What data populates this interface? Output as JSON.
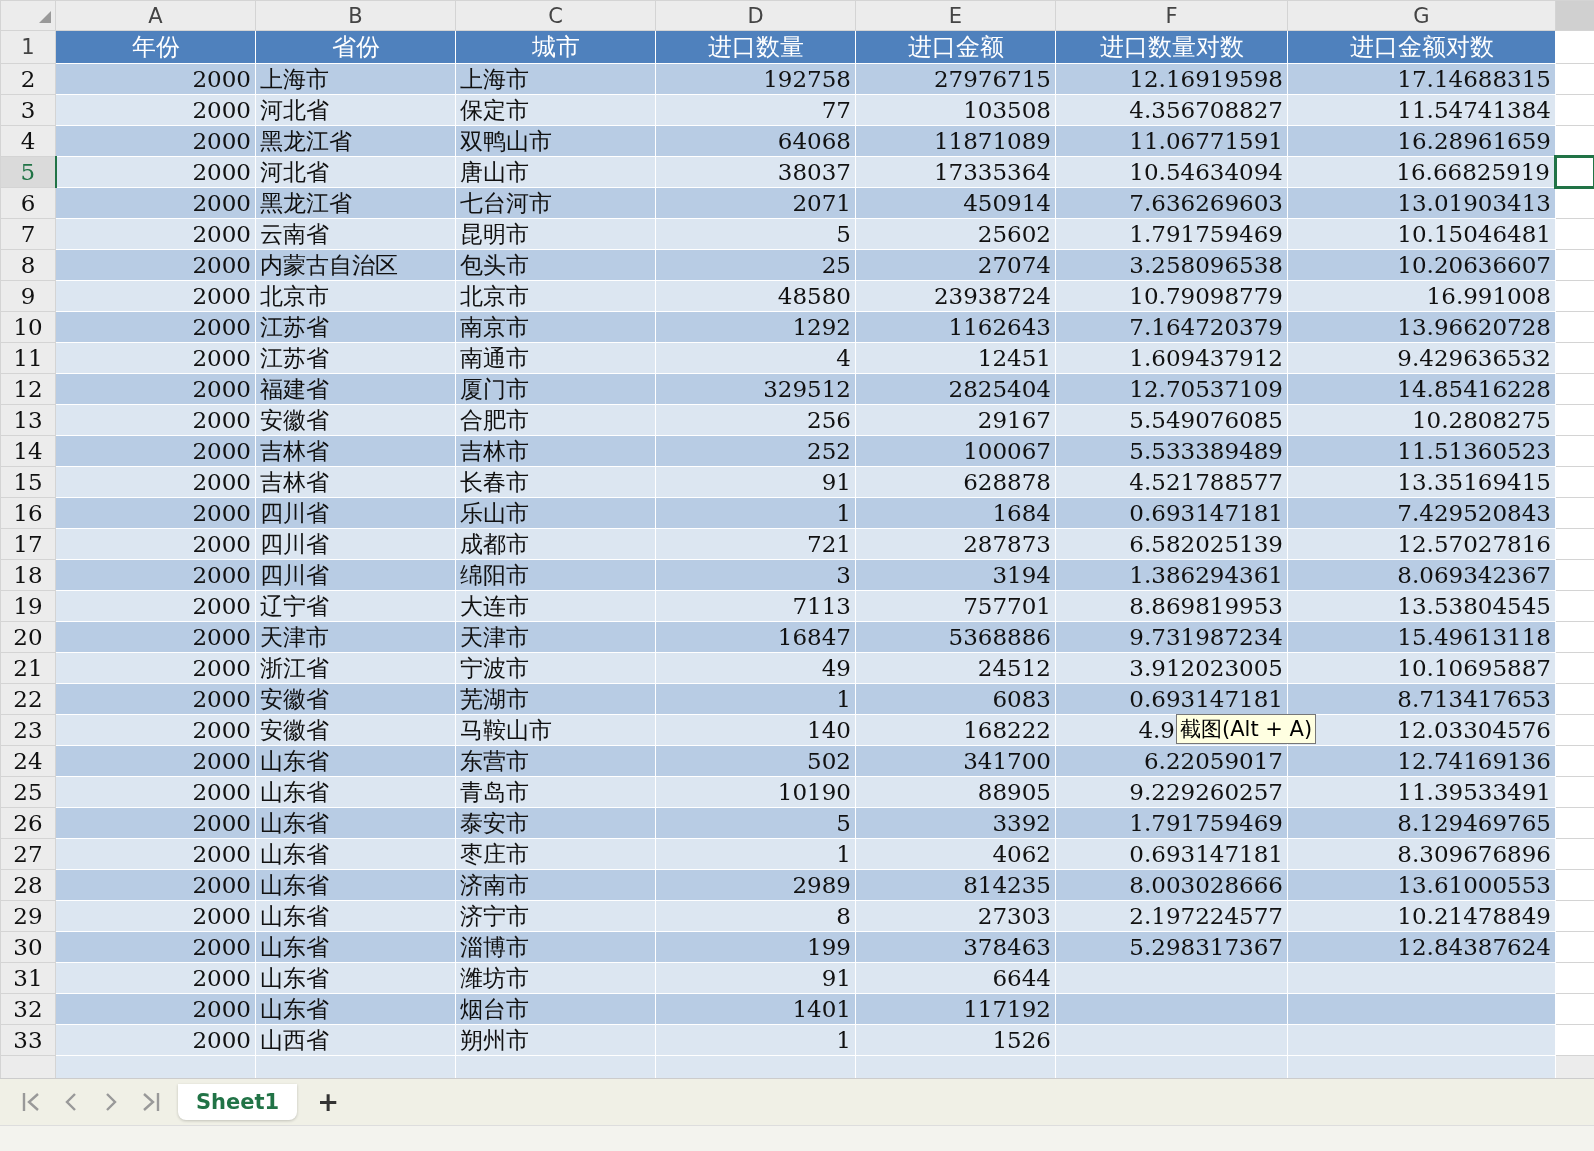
{
  "columns": [
    {
      "letter": "A",
      "selected": false
    },
    {
      "letter": "B",
      "selected": false
    },
    {
      "letter": "C",
      "selected": false
    },
    {
      "letter": "D",
      "selected": false
    },
    {
      "letter": "E",
      "selected": false
    },
    {
      "letter": "F",
      "selected": false
    },
    {
      "letter": "G",
      "selected": false
    }
  ],
  "header_row": {
    "number": "1",
    "cells": [
      "年份",
      "省份",
      "城市",
      "进口数量",
      "进口金额",
      "进口数量对数",
      "进口金额对数"
    ]
  },
  "rows": [
    {
      "number": "2",
      "selected": false,
      "cells": [
        "2000",
        "上海市",
        "上海市",
        "192758",
        "27976715",
        "12.16919598",
        "17.14688315"
      ]
    },
    {
      "number": "3",
      "selected": false,
      "cells": [
        "2000",
        "河北省",
        "保定市",
        "77",
        "103508",
        "4.356708827",
        "11.54741384"
      ]
    },
    {
      "number": "4",
      "selected": false,
      "cells": [
        "2000",
        "黑龙江省",
        "双鸭山市",
        "64068",
        "11871089",
        "11.06771591",
        "16.28961659"
      ]
    },
    {
      "number": "5",
      "selected": true,
      "cells": [
        "2000",
        "河北省",
        "唐山市",
        "38037",
        "17335364",
        "10.54634094",
        "16.66825919"
      ]
    },
    {
      "number": "6",
      "selected": false,
      "cells": [
        "2000",
        "黑龙江省",
        "七台河市",
        "2071",
        "450914",
        "7.636269603",
        "13.01903413"
      ]
    },
    {
      "number": "7",
      "selected": false,
      "cells": [
        "2000",
        "云南省",
        "昆明市",
        "5",
        "25602",
        "1.791759469",
        "10.15046481"
      ]
    },
    {
      "number": "8",
      "selected": false,
      "cells": [
        "2000",
        "内蒙古自治区",
        "包头市",
        "25",
        "27074",
        "3.258096538",
        "10.20636607"
      ]
    },
    {
      "number": "9",
      "selected": false,
      "cells": [
        "2000",
        "北京市",
        "北京市",
        "48580",
        "23938724",
        "10.79098779",
        "16.991008"
      ]
    },
    {
      "number": "10",
      "selected": false,
      "cells": [
        "2000",
        "江苏省",
        "南京市",
        "1292",
        "1162643",
        "7.164720379",
        "13.96620728"
      ]
    },
    {
      "number": "11",
      "selected": false,
      "cells": [
        "2000",
        "江苏省",
        "南通市",
        "4",
        "12451",
        "1.609437912",
        "9.429636532"
      ]
    },
    {
      "number": "12",
      "selected": false,
      "cells": [
        "2000",
        "福建省",
        "厦门市",
        "329512",
        "2825404",
        "12.70537109",
        "14.85416228"
      ]
    },
    {
      "number": "13",
      "selected": false,
      "cells": [
        "2000",
        "安徽省",
        "合肥市",
        "256",
        "29167",
        "5.549076085",
        "10.2808275"
      ]
    },
    {
      "number": "14",
      "selected": false,
      "cells": [
        "2000",
        "吉林省",
        "吉林市",
        "252",
        "100067",
        "5.533389489",
        "11.51360523"
      ]
    },
    {
      "number": "15",
      "selected": false,
      "cells": [
        "2000",
        "吉林省",
        "长春市",
        "91",
        "628878",
        "4.521788577",
        "13.35169415"
      ]
    },
    {
      "number": "16",
      "selected": false,
      "cells": [
        "2000",
        "四川省",
        "乐山市",
        "1",
        "1684",
        "0.693147181",
        "7.429520843"
      ]
    },
    {
      "number": "17",
      "selected": false,
      "cells": [
        "2000",
        "四川省",
        "成都市",
        "721",
        "287873",
        "6.582025139",
        "12.57027816"
      ]
    },
    {
      "number": "18",
      "selected": false,
      "cells": [
        "2000",
        "四川省",
        "绵阳市",
        "3",
        "3194",
        "1.386294361",
        "8.069342367"
      ]
    },
    {
      "number": "19",
      "selected": false,
      "cells": [
        "2000",
        "辽宁省",
        "大连市",
        "7113",
        "757701",
        "8.869819953",
        "13.53804545"
      ]
    },
    {
      "number": "20",
      "selected": false,
      "cells": [
        "2000",
        "天津市",
        "天津市",
        "16847",
        "5368886",
        "9.731987234",
        "15.49613118"
      ]
    },
    {
      "number": "21",
      "selected": false,
      "cells": [
        "2000",
        "浙江省",
        "宁波市",
        "49",
        "24512",
        "3.912023005",
        "10.10695887"
      ]
    },
    {
      "number": "22",
      "selected": false,
      "cells": [
        "2000",
        "安徽省",
        "芜湖市",
        "1",
        "6083",
        "0.693147181",
        "8.713417653"
      ]
    },
    {
      "number": "23",
      "selected": false,
      "cells": [
        "2000",
        "安徽省",
        "马鞍山市",
        "140",
        "168222",
        "4.9",
        "12.03304576"
      ],
      "tooltip": "截图(Alt + A)"
    },
    {
      "number": "24",
      "selected": false,
      "cells": [
        "2000",
        "山东省",
        "东营市",
        "502",
        "341700",
        "6.22059017",
        "12.74169136"
      ]
    },
    {
      "number": "25",
      "selected": false,
      "cells": [
        "2000",
        "山东省",
        "青岛市",
        "10190",
        "88905",
        "9.229260257",
        "11.39533491"
      ]
    },
    {
      "number": "26",
      "selected": false,
      "cells": [
        "2000",
        "山东省",
        "泰安市",
        "5",
        "3392",
        "1.791759469",
        "8.129469765"
      ]
    },
    {
      "number": "27",
      "selected": false,
      "cells": [
        "2000",
        "山东省",
        "枣庄市",
        "1",
        "4062",
        "0.693147181",
        "8.309676896"
      ]
    },
    {
      "number": "28",
      "selected": false,
      "cells": [
        "2000",
        "山东省",
        "济南市",
        "2989",
        "814235",
        "8.003028666",
        "13.61000553"
      ]
    },
    {
      "number": "29",
      "selected": false,
      "cells": [
        "2000",
        "山东省",
        "济宁市",
        "8",
        "27303",
        "2.197224577",
        "10.21478849"
      ]
    },
    {
      "number": "30",
      "selected": false,
      "cells": [
        "2000",
        "山东省",
        "淄博市",
        "199",
        "378463",
        "5.298317367",
        "12.84387624"
      ]
    },
    {
      "number": "31",
      "selected": false,
      "cells": [
        "2000",
        "山东省",
        "潍坊市",
        "91",
        "6644"
      ]
    },
    {
      "number": "32",
      "selected": false,
      "cells": [
        "2000",
        "山东省",
        "烟台市",
        "1401",
        "117192"
      ]
    },
    {
      "number": "33",
      "selected": false,
      "cells": [
        "2000",
        "山西省",
        "朔州市",
        "1",
        "1526"
      ]
    }
  ],
  "sheet_tabs": [
    {
      "label": "Sheet1",
      "selected": true
    }
  ],
  "add_sheet": "+"
}
